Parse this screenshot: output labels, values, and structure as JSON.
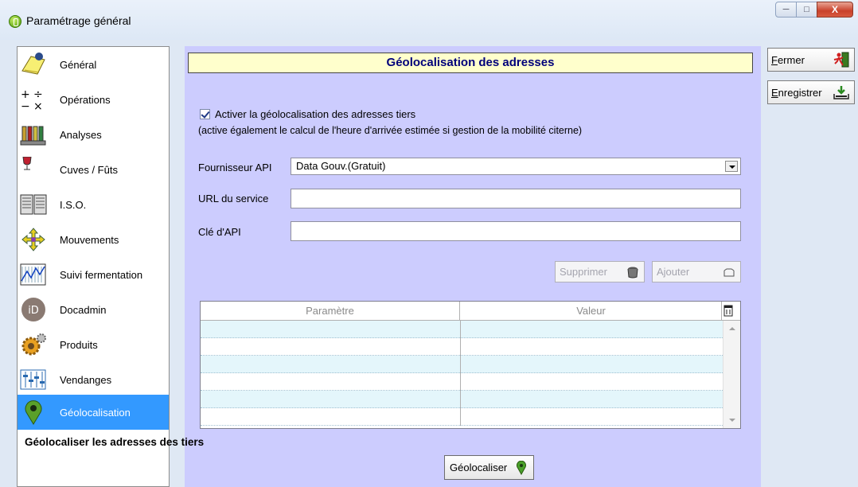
{
  "window": {
    "title": "Paramétrage général",
    "controls": {
      "minimize": "─",
      "maximize": "□",
      "close": "X"
    }
  },
  "sidebar": {
    "items": [
      {
        "label": "Général",
        "icon": "notepad-icon"
      },
      {
        "label": "Opérations",
        "icon": "math-operators-icon"
      },
      {
        "label": "Analyses",
        "icon": "test-tubes-icon"
      },
      {
        "label": "Cuves / Fûts",
        "icon": "wine-glass-icon"
      },
      {
        "label": "I.S.O.",
        "icon": "documents-icon"
      },
      {
        "label": "Mouvements",
        "icon": "arrows-cross-icon"
      },
      {
        "label": "Suivi fermentation",
        "icon": "chart-icon"
      },
      {
        "label": "Docadmin",
        "icon": "id-badge-icon",
        "badge": "iD"
      },
      {
        "label": "Produits",
        "icon": "gears-icon"
      },
      {
        "label": "Vendanges",
        "icon": "sliders-icon"
      },
      {
        "label": "Géolocalisation",
        "icon": "map-pin-icon",
        "active": true
      }
    ]
  },
  "main": {
    "heading": "Géolocalisation des adresses",
    "activate_checkbox": {
      "label": "Activer la géolocalisation des adresses tiers",
      "checked": true
    },
    "activate_note": "(active également le calcul de l'heure d'arrivée estimée si gestion de la mobilité citerne)",
    "provider": {
      "label": "Fournisseur API",
      "value": "Data Gouv.(Gratuit)"
    },
    "service_url": {
      "label": "URL du service",
      "value": ""
    },
    "api_key": {
      "label": "Clé d'API",
      "value": ""
    },
    "delete_button": "Supprimer",
    "add_button": "Ajouter",
    "table": {
      "columns": [
        "Paramètre",
        "Valeur"
      ],
      "rows": [
        [
          "",
          ""
        ],
        [
          "",
          ""
        ],
        [
          "",
          ""
        ],
        [
          "",
          ""
        ],
        [
          "",
          ""
        ],
        [
          "",
          ""
        ]
      ]
    },
    "geolocate_label": "Géolocaliser les adresses des tiers",
    "geolocate_button": "Géolocaliser"
  },
  "actions": {
    "close": {
      "label": "Fermer",
      "accel": "F",
      "rest": "ermer"
    },
    "save": {
      "label": "Enregistrer",
      "accel": "E",
      "rest": "nregistrer"
    }
  },
  "colors": {
    "panel_bg": "#ccccfe",
    "header_bg": "#ffffcc",
    "header_text": "#00007a",
    "active_item": "#3399ff",
    "grid_alt_row": "#e4f6fb"
  }
}
